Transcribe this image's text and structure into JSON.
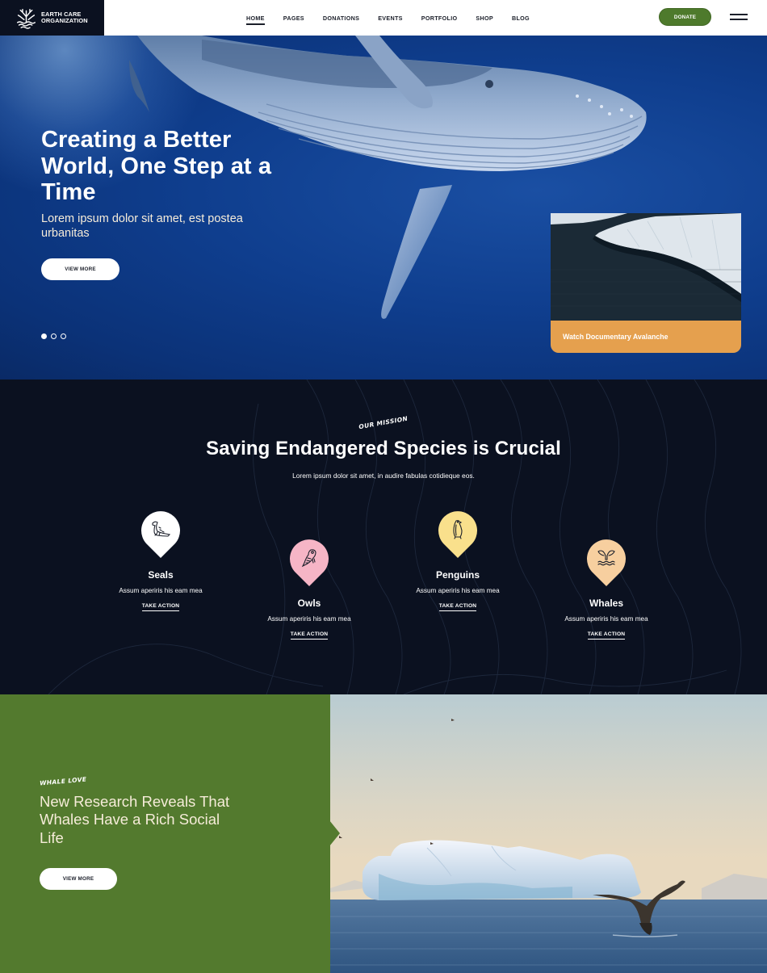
{
  "header": {
    "logo_line1": "Earth Care",
    "logo_line2": "Organization",
    "nav": [
      {
        "label": "Home",
        "active": true
      },
      {
        "label": "Pages",
        "active": false
      },
      {
        "label": "Donations",
        "active": false
      },
      {
        "label": "Events",
        "active": false
      },
      {
        "label": "Portfolio",
        "active": false
      },
      {
        "label": "Shop",
        "active": false
      },
      {
        "label": "Blog",
        "active": false
      }
    ],
    "donate_label": "Donate",
    "menu_icon": "hamburger-menu-icon"
  },
  "hero": {
    "title": "Creating a Better World, One Step at a Time",
    "subtitle": "Lorem ipsum dolor sit amet, est postea urbanitas",
    "button_label": "View More",
    "slides": {
      "count": 3,
      "active": 1
    },
    "doc_card": {
      "label": "Watch Documentary Avalanche",
      "color": "#e5a04e"
    }
  },
  "mission": {
    "eyebrow": "Our Mission",
    "title": "Saving Endangered Species is Crucial",
    "subtitle": "Lorem ipsum dolor sit amet, in audire fabulas cotidieque eos.",
    "species": [
      {
        "name": "Seals",
        "desc": "Assum aperiris his eam mea",
        "action": "Take Action",
        "icon": "seal-icon",
        "color": "#ffffff"
      },
      {
        "name": "Owls",
        "desc": "Assum aperiris his eam mea",
        "action": "Take Action",
        "icon": "owl-icon",
        "color": "#f6b5c6"
      },
      {
        "name": "Penguins",
        "desc": "Assum aperiris his eam mea",
        "action": "Take Action",
        "icon": "penguin-icon",
        "color": "#f9e08c"
      },
      {
        "name": "Whales",
        "desc": "Assum aperiris his eam mea",
        "action": "Take Action",
        "icon": "whale-tail-icon",
        "color": "#f7cf9f"
      }
    ]
  },
  "feature": {
    "eyebrow": "Whale Love",
    "title": "New Research Reveals That Whales Have a Rich Social Life",
    "button_label": "View More"
  },
  "colors": {
    "brand_green": "#537a2e",
    "donate_green": "#4e7a2c",
    "dark_navy": "#0b1120",
    "ocean_blue": "#0f3e8e",
    "accent_orange": "#e5a04e"
  }
}
